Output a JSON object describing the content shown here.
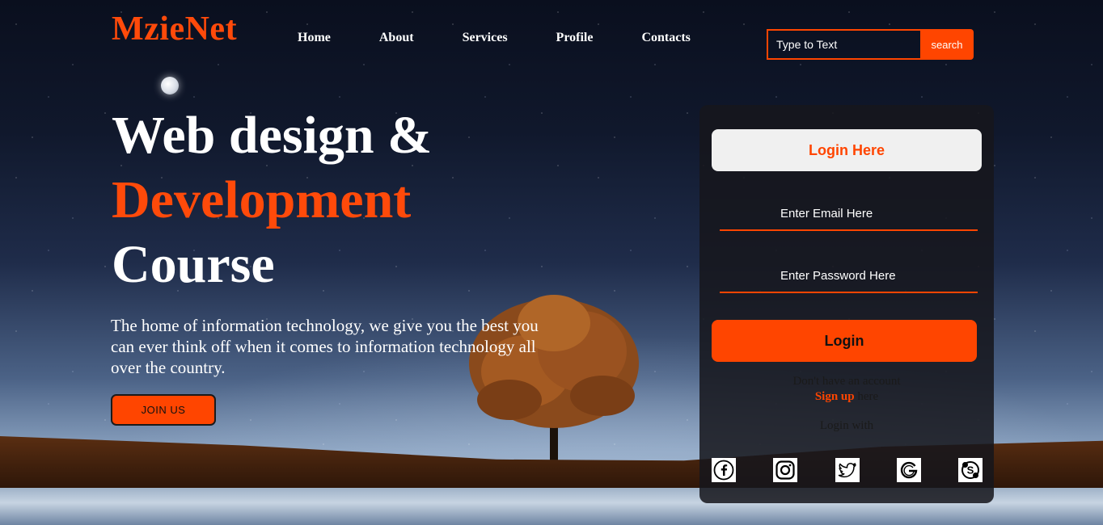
{
  "brand": {
    "logo": "MzieNet"
  },
  "nav": [
    {
      "label": "Home"
    },
    {
      "label": "About"
    },
    {
      "label": "Services"
    },
    {
      "label": "Profile"
    },
    {
      "label": "Contacts"
    }
  ],
  "search": {
    "placeholder": "Type to Text",
    "button": "search"
  },
  "hero": {
    "line1": "Web design &",
    "line2": "Development",
    "line3": "Course",
    "description": "The home of information technology, we give you the best you can ever think off when it comes to information technology all over the country.",
    "cta": "JOIN US"
  },
  "login": {
    "title": "Login Here",
    "email_placeholder": "Enter Email Here",
    "password_placeholder": "Enter Password Here",
    "button": "Login",
    "no_account": "Don't have an account",
    "signup_link": "Sign up",
    "signup_suffix": " here",
    "login_with": "Login with",
    "socials": [
      "facebook-icon",
      "instagram-icon",
      "twitter-icon",
      "google-icon",
      "skype-icon"
    ]
  },
  "colors": {
    "accent": "#ff4500",
    "panel": "#16161c",
    "text": "#ffffff"
  }
}
